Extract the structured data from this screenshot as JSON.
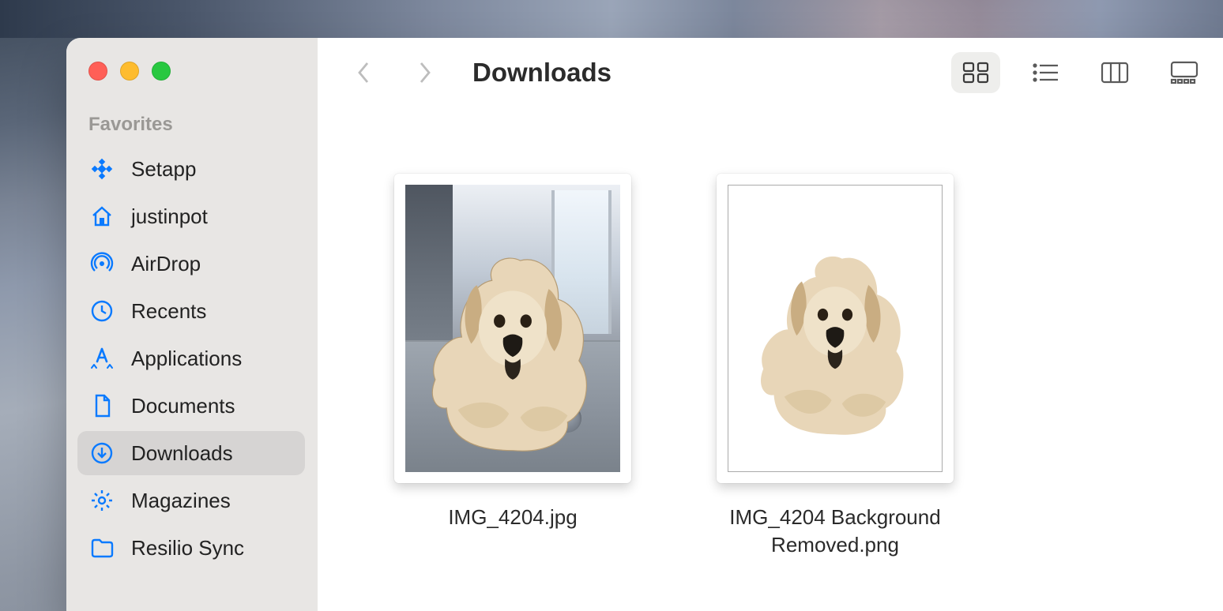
{
  "colors": {
    "accent": "#0a7aff"
  },
  "window": {
    "title": "Downloads"
  },
  "sidebar": {
    "section": "Favorites",
    "items": [
      {
        "icon": "setapp-icon",
        "label": "Setapp"
      },
      {
        "icon": "home-icon",
        "label": "justinpot"
      },
      {
        "icon": "airdrop-icon",
        "label": "AirDrop"
      },
      {
        "icon": "clock-icon",
        "label": "Recents"
      },
      {
        "icon": "applications-icon",
        "label": "Applications"
      },
      {
        "icon": "document-icon",
        "label": "Documents"
      },
      {
        "icon": "downloads-icon",
        "label": "Downloads",
        "active": true
      },
      {
        "icon": "gear-icon",
        "label": "Magazines"
      },
      {
        "icon": "folder-icon",
        "label": "Resilio Sync"
      }
    ]
  },
  "toolbar": {
    "views": [
      {
        "name": "icon-view",
        "active": true
      },
      {
        "name": "list-view",
        "active": false
      },
      {
        "name": "column-view",
        "active": false
      },
      {
        "name": "gallery-view",
        "active": false
      }
    ]
  },
  "files": [
    {
      "name": "IMG_4204.jpg",
      "kind": "photo"
    },
    {
      "name": "IMG_4204 Background Removed.png",
      "kind": "cutout"
    }
  ]
}
